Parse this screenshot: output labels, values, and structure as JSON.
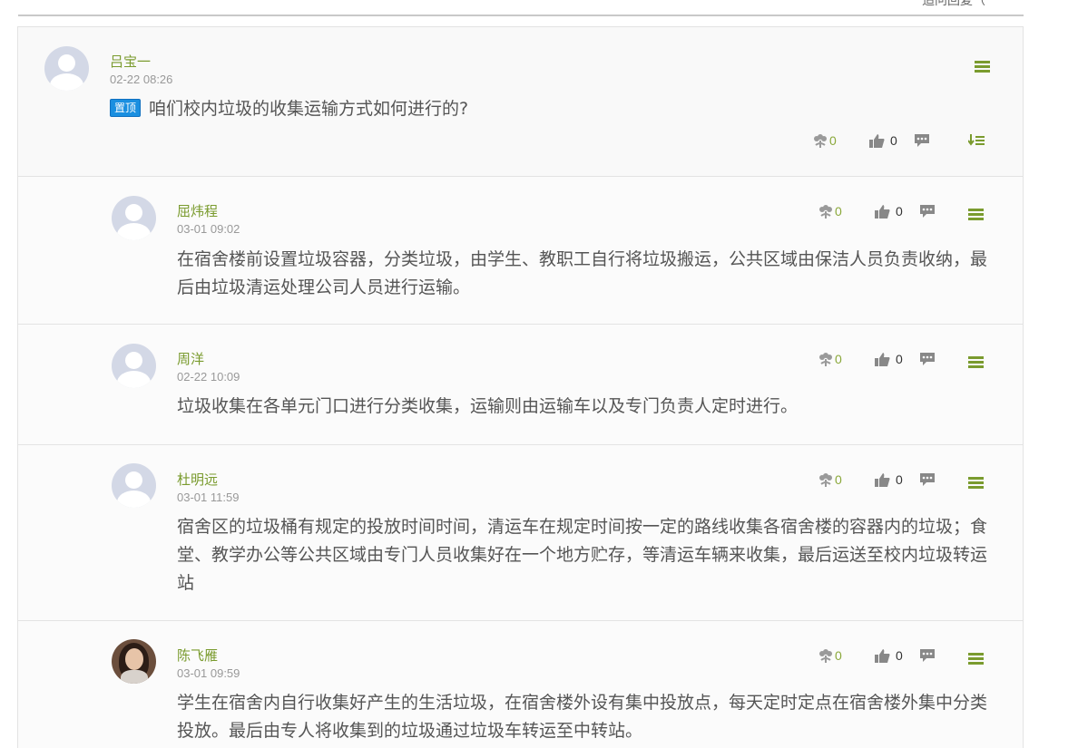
{
  "header_fragment": "追问回复（",
  "main_post": {
    "author": "吕宝一",
    "time": "02-22 08:26",
    "badge": "置顶",
    "question": "咱们校内垃圾的收集运输方式如何进行的?",
    "flowers": "0",
    "likes": "0"
  },
  "replies": [
    {
      "author": "屈炜程",
      "time": "03-01 09:02",
      "content": "在宿舍楼前设置垃圾容器，分类垃圾，由学生、教职工自行将垃圾搬运，公共区域由保洁人员负责收纳，最后由垃圾清运处理公司人员进行运输。",
      "flowers": "0",
      "likes": "0"
    },
    {
      "author": "周洋",
      "time": "02-22 10:09",
      "content": "垃圾收集在各单元门口进行分类收集，运输则由运输车以及专门负责人定时进行。",
      "flowers": "0",
      "likes": "0"
    },
    {
      "author": "杜明远",
      "time": "03-01 11:59",
      "content": "宿舍区的垃圾桶有规定的投放时间时间，清运车在规定时间按一定的路线收集各宿舍楼的容器内的垃圾；食堂、教学办公等公共区域由专门人员收集好在一个地方贮存，等清运车辆来收集，最后运送至校内垃圾转运站",
      "flowers": "0",
      "likes": "0"
    },
    {
      "author": "陈飞雁",
      "time": "03-01 09:59",
      "content": "学生在宿舍内自行收集好产生的生活垃圾，在宿舍楼外设有集中投放点，每天定时定点在宿舍楼外集中分类投放。最后由专人将收集到的垃圾通过垃圾车转运至中转站。",
      "flowers": "0",
      "likes": "0"
    }
  ],
  "colors": {
    "accent_green": "#7a9b2e",
    "badge_blue": "#1a8fe0",
    "icon_gray": "#9a9a9a"
  },
  "icons": [
    "flower-icon",
    "thumbs-up-icon",
    "comment-icon",
    "menu-icon",
    "sort-icon"
  ]
}
